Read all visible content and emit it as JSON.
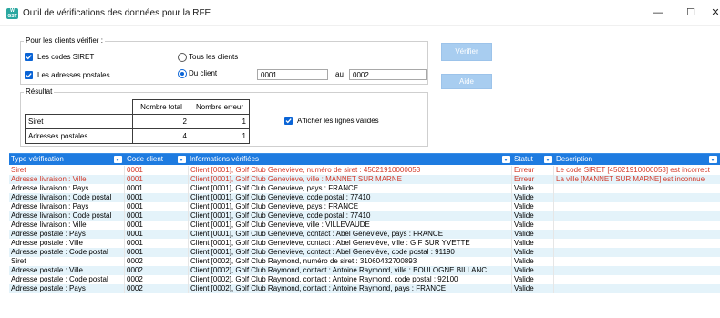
{
  "window": {
    "title": "Outil de vérifications des données pour la RFE",
    "icon_text_top": "W",
    "icon_text_bottom": "GST",
    "minimize": "—",
    "maximize": "☐",
    "close": "✕"
  },
  "check_group": {
    "legend": "Pour les clients vérifier :",
    "siret_label": "Les codes SIRET",
    "siret_checked": true,
    "addresses_label": "Les adresses postales",
    "addresses_checked": true,
    "all_clients_label": "Tous les clients",
    "from_client_label": "Du client",
    "from_value": "0001",
    "to_label": "au",
    "to_value": "0002"
  },
  "buttons": {
    "verify": "Vérifier",
    "help": "Aide"
  },
  "result_group": {
    "legend": "Résultat",
    "col_total": "Nombre total",
    "col_errors": "Nombre erreur",
    "rows": [
      {
        "label": "Siret",
        "total": "2",
        "errors": "1"
      },
      {
        "label": "Adresses postales",
        "total": "4",
        "errors": "1"
      }
    ],
    "show_valid_label": "Afficher les lignes valides",
    "show_valid_checked": true
  },
  "grid": {
    "columns": [
      "Type vérification",
      "Code client",
      "Informations vérifiées",
      "Statut",
      "Description"
    ],
    "rows": [
      {
        "type": "Siret",
        "code": "0001",
        "info": "Client [0001], Golf Club Geneviève, numéro de siret : 45021910000053",
        "status": "Erreur",
        "desc": "Le code SIRET [45021910000053] est incorrect",
        "err": true
      },
      {
        "type": "Adresse livraison : Ville",
        "code": "0001",
        "info": "Client [0001], Golf Club Geneviève, ville : MANNET SUR MARNE",
        "status": "Erreur",
        "desc": "La ville [MANNET SUR MARNE] est inconnue",
        "err": true
      },
      {
        "type": "Adresse livraison : Pays",
        "code": "0001",
        "info": "Client [0001], Golf Club Geneviève, pays : FRANCE",
        "status": "Valide",
        "desc": "",
        "err": false
      },
      {
        "type": "Adresse livraison : Code postal",
        "code": "0001",
        "info": "Client [0001], Golf Club Geneviève, code postal : 77410",
        "status": "Valide",
        "desc": "",
        "err": false
      },
      {
        "type": "Adresse livraison : Pays",
        "code": "0001",
        "info": "Client [0001], Golf Club Geneviève, pays : FRANCE",
        "status": "Valide",
        "desc": "",
        "err": false
      },
      {
        "type": "Adresse livraison : Code postal",
        "code": "0001",
        "info": "Client [0001], Golf Club Geneviève, code postal : 77410",
        "status": "Valide",
        "desc": "",
        "err": false
      },
      {
        "type": "Adresse livraison : Ville",
        "code": "0001",
        "info": "Client [0001], Golf Club Geneviève, ville : VILLEVAUDE",
        "status": "Valide",
        "desc": "",
        "err": false
      },
      {
        "type": "Adresse postale : Pays",
        "code": "0001",
        "info": "Client [0001], Golf Club Geneviève, contact : Abel Geneviève, pays : FRANCE",
        "status": "Valide",
        "desc": "",
        "err": false
      },
      {
        "type": "Adresse postale : Ville",
        "code": "0001",
        "info": "Client [0001], Golf Club Geneviève, contact : Abel Geneviève, ville : GIF SUR YVETTE",
        "status": "Valide",
        "desc": "",
        "err": false
      },
      {
        "type": "Adresse postale : Code postal",
        "code": "0001",
        "info": "Client [0001], Golf Club Geneviève, contact : Abel Geneviève, code postal : 91190",
        "status": "Valide",
        "desc": "",
        "err": false
      },
      {
        "type": "Siret",
        "code": "0002",
        "info": "Client [0002], Golf Club Raymond, numéro de siret : 31060432700893",
        "status": "Valide",
        "desc": "",
        "err": false
      },
      {
        "type": "Adresse postale : Ville",
        "code": "0002",
        "info": "Client [0002], Golf Club Raymond, contact : Antoine Raymond, ville : BOULOGNE BILLANC...",
        "status": "Valide",
        "desc": "",
        "err": false
      },
      {
        "type": "Adresse postale : Code postal",
        "code": "0002",
        "info": "Client [0002], Golf Club Raymond, contact : Antoine Raymond, code postal : 92100",
        "status": "Valide",
        "desc": "",
        "err": false
      },
      {
        "type": "Adresse postale : Pays",
        "code": "0002",
        "info": "Client [0002], Golf Club Raymond, contact : Antoine Raymond, pays : FRANCE",
        "status": "Valide",
        "desc": "",
        "err": false
      }
    ]
  },
  "colors": {
    "accent": "#1e7be0",
    "error_text": "#d23a2a",
    "alt_row": "#e4f3fa",
    "button": "#a8cdf0"
  }
}
